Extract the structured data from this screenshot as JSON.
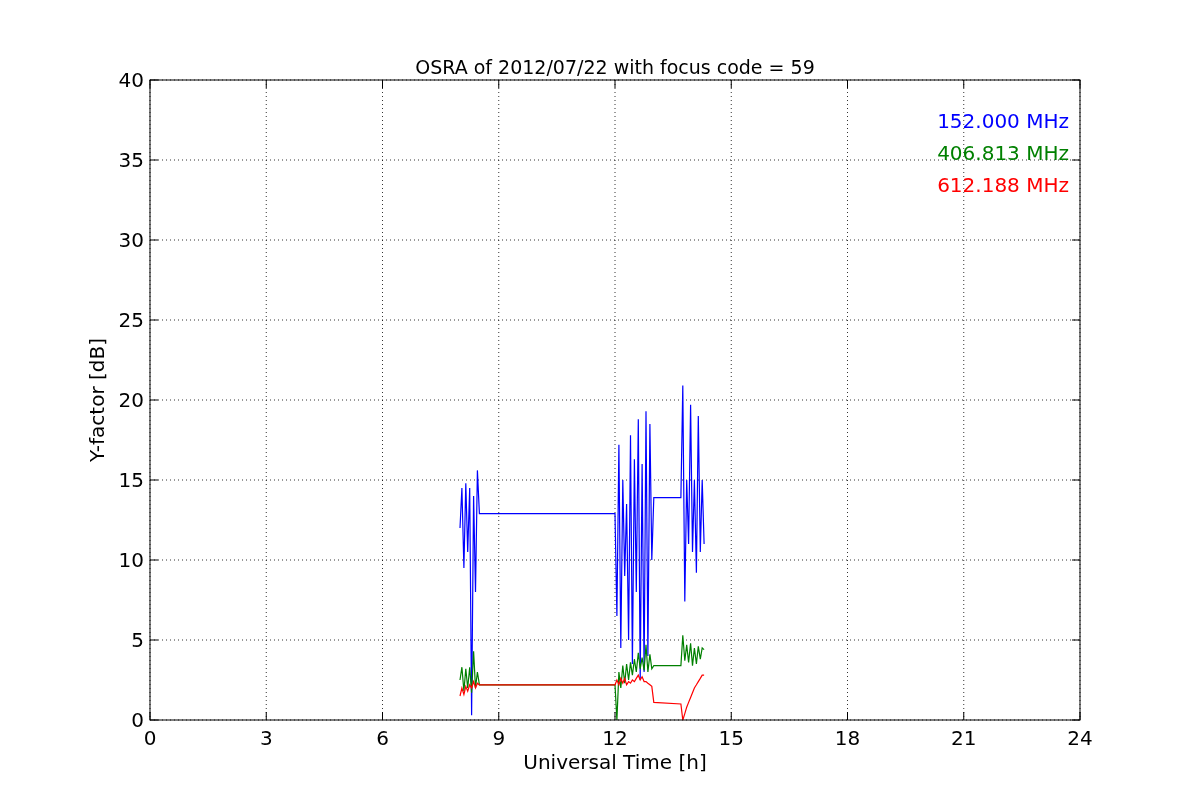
{
  "chart_data": {
    "type": "line",
    "title": "OSRA of 2012/07/22 with focus code = 59",
    "xlabel": "Universal Time [h]",
    "ylabel": "Y-factor [dB]",
    "x": [
      8.0,
      8.05,
      8.1,
      8.15,
      8.2,
      8.25,
      8.3,
      8.35,
      8.4,
      8.45,
      8.5,
      12.0,
      12.05,
      12.1,
      12.15,
      12.2,
      12.25,
      12.3,
      12.35,
      12.4,
      12.45,
      12.5,
      12.55,
      12.6,
      12.65,
      12.7,
      12.75,
      12.8,
      12.85,
      12.9,
      12.95,
      13.0,
      13.7,
      13.75,
      13.8,
      13.85,
      13.9,
      13.95,
      14.0,
      14.05,
      14.1,
      14.15,
      14.2,
      14.25,
      14.3
    ],
    "series": [
      {
        "name": "152.000 MHz",
        "color": "#0000ff",
        "values": [
          12.0,
          14.5,
          9.5,
          14.8,
          10.5,
          14.5,
          0.3,
          14.0,
          8.0,
          15.6,
          12.9,
          12.9,
          6.5,
          17.2,
          4.5,
          15.0,
          9.0,
          13.5,
          5.0,
          17.8,
          3.5,
          16.3,
          8.0,
          18.8,
          2.5,
          16.0,
          3.0,
          19.3,
          4.0,
          18.5,
          10.0,
          13.9,
          13.9,
          20.9,
          7.4,
          15.0,
          11.0,
          19.7,
          10.5,
          15.0,
          9.2,
          19.0,
          10.5,
          15.0,
          11.0
        ]
      },
      {
        "name": "406.813 MHz",
        "color": "#008000",
        "values": [
          2.5,
          3.3,
          1.8,
          3.2,
          2.0,
          3.3,
          1.7,
          4.3,
          2.0,
          3.0,
          2.2,
          2.2,
          0.0,
          3.0,
          2.0,
          3.4,
          2.3,
          3.5,
          2.5,
          3.6,
          2.8,
          3.8,
          3.0,
          4.2,
          3.2,
          3.9,
          3.1,
          4.7,
          3.0,
          4.1,
          3.2,
          3.4,
          3.4,
          5.3,
          3.7,
          4.7,
          3.6,
          4.8,
          3.4,
          4.5,
          3.5,
          4.6,
          3.8,
          4.5,
          4.4
        ]
      },
      {
        "name": "612.188 MHz",
        "color": "#ff0000",
        "values": [
          1.5,
          2.0,
          1.6,
          2.1,
          1.8,
          2.2,
          2.0,
          2.4,
          2.0,
          2.3,
          2.2,
          2.2,
          2.5,
          2.2,
          2.6,
          2.3,
          2.6,
          2.2,
          2.4,
          2.3,
          2.5,
          2.4,
          2.6,
          2.8,
          2.5,
          2.7,
          2.4,
          2.4,
          2.3,
          2.2,
          2.1,
          1.1,
          1.0,
          0.0,
          0.4,
          0.8,
          1.1,
          1.4,
          1.7,
          2.0,
          2.2,
          2.4,
          2.6,
          2.8,
          2.8
        ]
      }
    ],
    "grid": true,
    "xlim": [
      0,
      24
    ],
    "ylim": [
      0,
      40
    ],
    "xticks": [
      0,
      3,
      6,
      9,
      12,
      15,
      18,
      21,
      24
    ],
    "yticks": [
      0,
      5,
      10,
      15,
      20,
      25,
      30,
      35,
      40
    ]
  }
}
